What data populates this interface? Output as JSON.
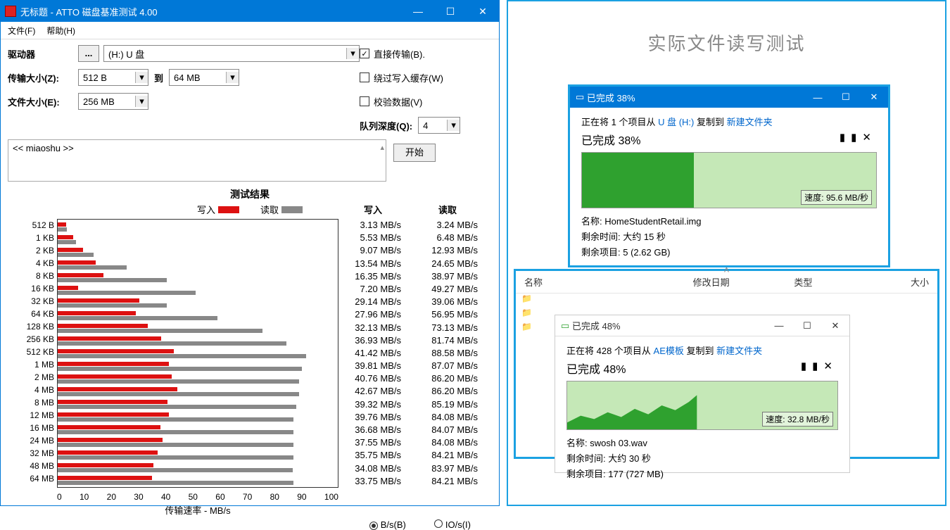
{
  "atto": {
    "title": "无标题 - ATTO 磁盘基准测试 4.00",
    "menu": {
      "file": "文件(F)",
      "help": "帮助(H)"
    },
    "labels": {
      "drive": "驱动器",
      "transfer_size": "传输大小(Z):",
      "to": "到",
      "file_size": "文件大小(E):",
      "queue_depth": "队列深度(Q):",
      "direct_io": "直接传输(B).",
      "bypass_cache": "绕过写入缓存(W)",
      "verify": "校验数据(V)",
      "start": "开始",
      "results_title": "测试结果",
      "legend_write": "写入",
      "legend_read": "读取",
      "col_write": "写入",
      "col_read": "读取",
      "xaxis": "传输速率 - MB/s",
      "unit_bs": "B/s(B)",
      "unit_ios": "IO/s(I)"
    },
    "values": {
      "drive": "(H:) U 盘",
      "ts_from": "512 B",
      "ts_to": "64 MB",
      "file_size": "256 MB",
      "queue_depth": "4",
      "direct_io_checked": true,
      "description": "<< miaoshu >>"
    },
    "xticks": [
      "0",
      "10",
      "20",
      "30",
      "40",
      "50",
      "60",
      "70",
      "80",
      "90",
      "100"
    ]
  },
  "chart_data": {
    "type": "bar",
    "title": "测试结果",
    "xlabel": "传输速率 - MB/s",
    "xlim": [
      0,
      100
    ],
    "categories": [
      "512 B",
      "1 KB",
      "2 KB",
      "4 KB",
      "8 KB",
      "16 KB",
      "32 KB",
      "64 KB",
      "128 KB",
      "256 KB",
      "512 KB",
      "1 MB",
      "2 MB",
      "4 MB",
      "8 MB",
      "12 MB",
      "16 MB",
      "24 MB",
      "32 MB",
      "48 MB",
      "64 MB"
    ],
    "series": [
      {
        "name": "写入",
        "unit": "MB/s",
        "values": [
          3.13,
          5.53,
          9.07,
          13.54,
          16.35,
          7.2,
          29.14,
          27.96,
          32.13,
          36.93,
          41.42,
          39.81,
          40.76,
          42.67,
          39.32,
          39.76,
          36.68,
          37.55,
          35.75,
          34.08,
          33.75
        ]
      },
      {
        "name": "读取",
        "unit": "MB/s",
        "values": [
          3.24,
          6.48,
          12.93,
          24.65,
          38.97,
          49.27,
          39.06,
          56.95,
          73.13,
          81.74,
          88.58,
          87.07,
          86.2,
          86.2,
          85.19,
          84.08,
          84.07,
          84.08,
          84.21,
          83.97,
          84.21
        ]
      }
    ]
  },
  "right": {
    "heading": "实际文件读写测试",
    "columns": {
      "name": "名称",
      "date": "修改日期",
      "type": "类型",
      "size": "大小"
    },
    "copy1": {
      "title": "已完成 38%",
      "line_prefix": "正在将 1 个项目从 ",
      "src": "U 盘 (H:)",
      "mid": " 复制到 ",
      "dst": "新建文件夹",
      "pct_line": "已完成 38%",
      "speed": "速度: 95.6 MB/秒",
      "meta_name_l": "名称:",
      "meta_name_v": "HomeStudentRetail.img",
      "meta_time_l": "剩余时间:",
      "meta_time_v": "大约 15 秒",
      "meta_items_l": "剩余项目:",
      "meta_items_v": "5 (2.62 GB)",
      "fill_pct": 38
    },
    "copy2": {
      "title": "已完成 48%",
      "line_prefix": "正在将 428 个项目从 ",
      "src": "AE模板",
      "mid": " 复制到 ",
      "dst": "新建文件夹",
      "pct_line": "已完成 48%",
      "speed": "速度: 32.8 MB/秒",
      "meta_name_l": "名称:",
      "meta_name_v": "swosh 03.wav",
      "meta_time_l": "剩余时间:",
      "meta_time_v": "大约 30 秒",
      "meta_items_l": "剩余项目:",
      "meta_items_v": "177 (727 MB)",
      "fill_pct": 48
    }
  }
}
